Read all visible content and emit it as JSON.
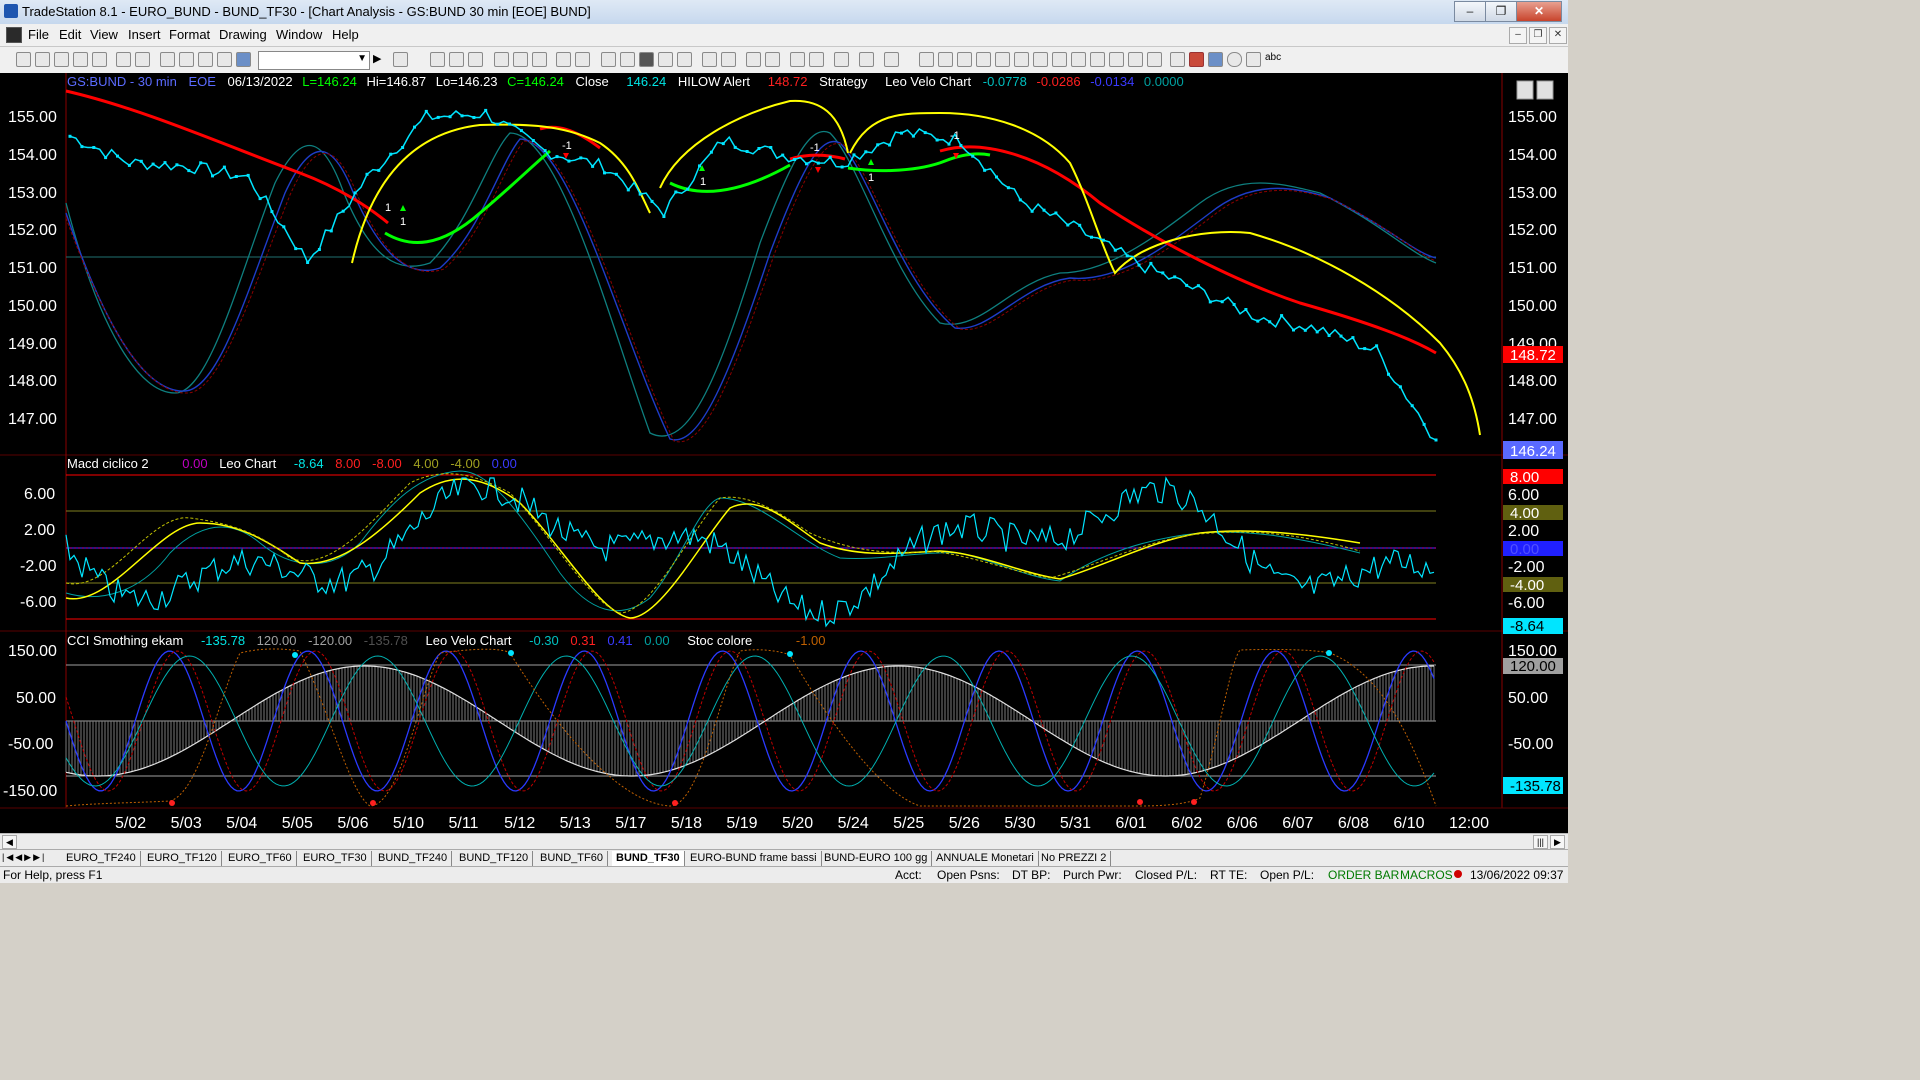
{
  "window": {
    "title": "TradeStation 8.1 - EURO_BUND - BUND_TF30 - [Chart Analysis - GS:BUND  30 min  [EOE] BUND]"
  },
  "menu": [
    "File",
    "Edit",
    "View",
    "Insert",
    "Format",
    "Drawing",
    "Window",
    "Help"
  ],
  "chart": {
    "header": {
      "symbol": "GS:BUND - 30 min",
      "exchange": "EOE",
      "date": "06/13/2022",
      "last": "L=146.24",
      "high": "Hi=146.87",
      "low": "Lo=146.23",
      "close_eq": "C=146.24",
      "close_label": "Close",
      "close_value": "146.24",
      "hilow": "HILOW Alert",
      "hilow_value": "148.72",
      "strategy": "Strategy",
      "leo_velo": "Leo Velo Chart",
      "leo_vals": [
        "-0.0778",
        "-0.0286",
        "-0.0134",
        "0.0000"
      ]
    },
    "price_axis": [
      "155.00",
      "154.00",
      "153.00",
      "152.00",
      "151.00",
      "150.00",
      "149.00",
      "148.00",
      "147.00"
    ],
    "price_tags": {
      "hilow": "148.72",
      "last": "146.24"
    },
    "strategy_marks": [
      "1",
      "1",
      "-1",
      "1",
      "-1",
      "1",
      "-1"
    ],
    "macd": {
      "title": "Macd ciclico 2",
      "v0": "0.00",
      "leo": "Leo Chart",
      "vals": [
        "-8.64",
        "8.00",
        "-8.00",
        "4.00",
        "-4.00",
        "0.00"
      ],
      "axis": [
        "6.00",
        "2.00",
        "-2.00",
        "-6.00"
      ],
      "tags": [
        "8.00",
        "6.00",
        "4.00",
        "2.00",
        "0.00",
        "-2.00",
        "-4.00",
        "-6.00",
        "-8.64"
      ]
    },
    "cci": {
      "title": "CCI Smothing ekam",
      "vals": [
        "-135.78",
        "120.00",
        "-120.00",
        "-135.78"
      ],
      "leo": "Leo Velo Chart",
      "leo_vals": [
        "-0.30",
        "0.31",
        "0.41",
        "0.00"
      ],
      "stoc": "Stoc colore",
      "stoc_val": "-1.00",
      "axis": [
        "150.00",
        "50.00",
        "-50.00",
        "-150.00"
      ],
      "tags": [
        "150.00",
        "120.00",
        "50.00",
        "-50.00",
        "-135.78"
      ]
    },
    "dates": [
      "5/02",
      "5/03",
      "5/04",
      "5/05",
      "5/06",
      "5/10",
      "5/11",
      "5/12",
      "5/13",
      "5/17",
      "5/18",
      "5/19",
      "5/20",
      "5/24",
      "5/25",
      "5/26",
      "5/30",
      "5/31",
      "6/01",
      "6/02",
      "6/06",
      "6/07",
      "6/08",
      "6/10",
      "12:00"
    ]
  },
  "chart_data": {
    "type": "line",
    "title": "GS:BUND - 30 min",
    "x": [
      "5/02",
      "5/03",
      "5/04",
      "5/05",
      "5/06",
      "5/10",
      "5/11",
      "5/12",
      "5/13",
      "5/17",
      "5/18",
      "5/19",
      "5/20",
      "5/24",
      "5/25",
      "5/26",
      "5/30",
      "5/31",
      "6/01",
      "6/02",
      "6/06",
      "6/07",
      "6/08",
      "6/10"
    ],
    "series": [
      {
        "name": "Close",
        "values": [
          154.3,
          153.6,
          153.5,
          153.2,
          151.0,
          153.2,
          154.8,
          154.9,
          153.9,
          153.5,
          152.3,
          154.2,
          153.8,
          153.6,
          154.4,
          154.2,
          152.6,
          151.8,
          150.9,
          150.2,
          149.5,
          149.2,
          148.6,
          146.24
        ]
      }
    ],
    "ylim": [
      146.0,
      155.5
    ],
    "grid": false
  },
  "tabs": [
    "EURO_TF240",
    "EURO_TF120",
    "EURO_TF60",
    "EURO_TF30",
    "BUND_TF240",
    "BUND_TF120",
    "BUND_TF60",
    "BUND_TF30",
    "EURO-BUND frame bassi",
    "BUND-EURO 100 gg",
    "ANNUALE Monetari",
    "No PREZZI 2"
  ],
  "active_tab": "BUND_TF30",
  "status": {
    "help": "For Help, press F1",
    "acct": "Acct:",
    "open_psns": "Open Psns:",
    "dt_bp": "DT BP:",
    "purch_pwr": "Purch Pwr:",
    "closed_pl": "Closed P/L:",
    "rt_te": "RT TE:",
    "open_pl": "Open P/L:",
    "order_bar": "ORDER BAR",
    "macros": "MACROS",
    "clock": "13/06/2022 09:37"
  }
}
